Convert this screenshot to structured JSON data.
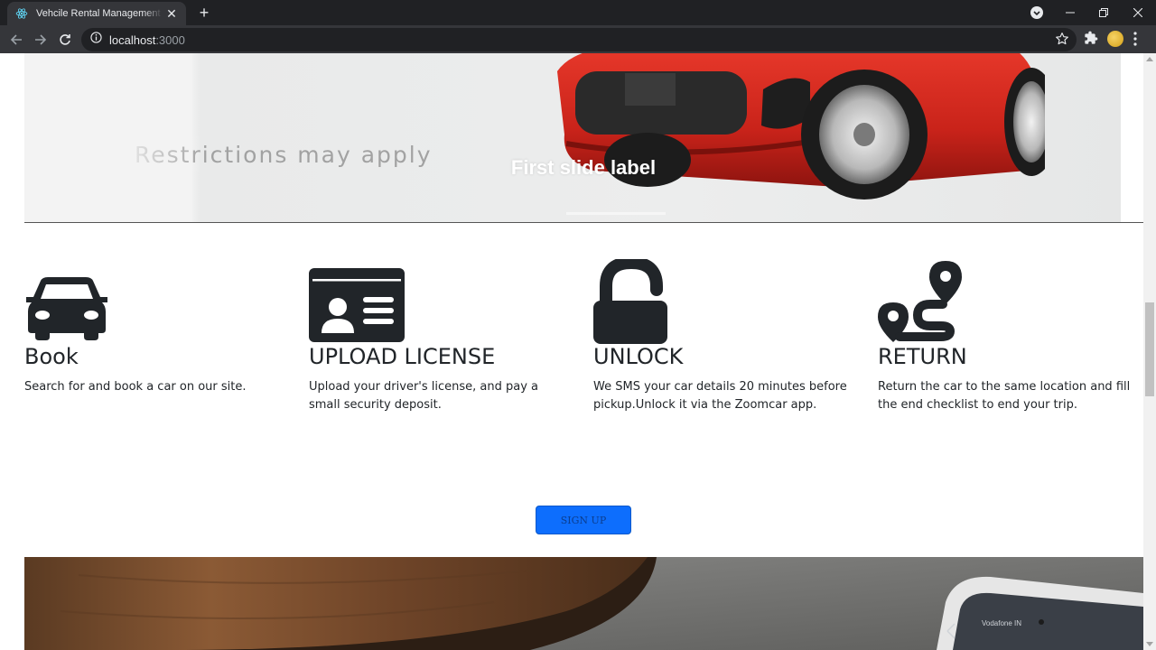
{
  "browser": {
    "tab_title": "Vehcile Rental Management System",
    "tab_close": "✕",
    "new_tab": "+",
    "url_host": "localhost",
    "url_port": ":3000"
  },
  "carousel": {
    "slide_label": "First slide label",
    "image_text": "Restrictions may apply"
  },
  "steps": [
    {
      "icon": "car-icon",
      "title": "Book",
      "description": "Search for and book a car on our site."
    },
    {
      "icon": "id-card-icon",
      "title": "UPLOAD LICENSE",
      "description": "Upload your driver's license, and pay a small security deposit."
    },
    {
      "icon": "unlock-icon",
      "title": "UNLOCK",
      "description": "We SMS your car details 20 minutes before pickup.Unlock it via the Zoomcar app."
    },
    {
      "icon": "route-icon",
      "title": "RETURN",
      "description": "Return the car to the same location and fill the end checklist to end your trip."
    }
  ],
  "signup": {
    "label": "SIGN UP"
  },
  "bottom_image": {
    "phone_text": "Vodafone IN"
  },
  "colors": {
    "primary": "#0d6efd",
    "icon": "#212529",
    "chrome": "#35363a",
    "car": "#d42a1e"
  }
}
